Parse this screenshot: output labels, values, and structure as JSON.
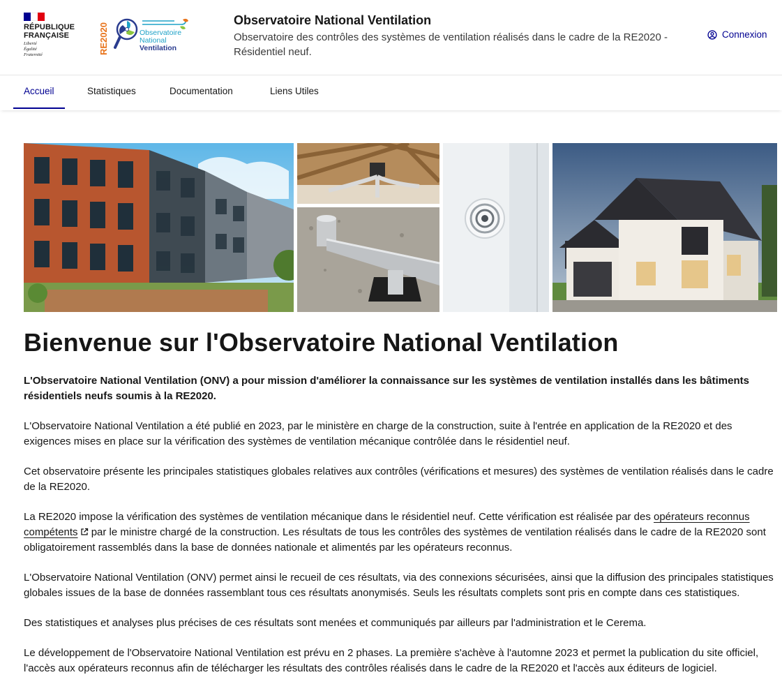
{
  "header": {
    "republic_line1": "RÉPUBLIQUE",
    "republic_line2": "FRANÇAISE",
    "motto_line1": "Liberté",
    "motto_line2": "Égalité",
    "motto_line3": "Fraternité",
    "logo_vertical_text": "RE2020",
    "logo_line1": "Observatoire",
    "logo_line2": "National",
    "logo_line3": "Ventilation",
    "site_title": "Observatoire National Ventilation",
    "site_tagline": "Observatoire des contrôles des systèmes de ventilation réalisés dans le cadre de la RE2020 - Résidentiel neuf.",
    "login_label": "Connexion"
  },
  "nav": {
    "items": [
      {
        "label": "Accueil",
        "active": true
      },
      {
        "label": "Statistiques",
        "active": false
      },
      {
        "label": "Documentation",
        "active": false
      },
      {
        "label": "Liens Utiles",
        "active": false
      }
    ]
  },
  "hero": {
    "images": [
      "apartment-buildings-photo",
      "attic-ventilation-ducts-photo",
      "roof-duct-photo",
      "wall-vent-photo",
      "house-photo"
    ]
  },
  "main": {
    "title": "Bienvenue sur l'Observatoire National Ventilation",
    "lead": "L'Observatoire National Ventilation (ONV) a pour mission d'améliorer la connaissance sur les systèmes de ventilation installés dans les bâtiments résidentiels neufs soumis à la RE2020.",
    "p1": "L'Observatoire National Ventilation a été publié en 2023, par le ministère en charge de la construction, suite à l'entrée en application de la RE2020 et des exigences mises en place sur la vérification des systèmes de ventilation mécanique contrôlée dans le résidentiel neuf.",
    "p2": "Cet observatoire présente les principales statistiques globales relatives aux contrôles (vérifications et mesures) des systèmes de ventilation réalisés dans le cadre de la RE2020.",
    "p3_before": "La RE2020 impose la vérification des systèmes de ventilation mécanique dans le résidentiel neuf. Cette vérification est réalisée par des ",
    "p3_link": "opérateurs reconnus compétents",
    "p3_after": " par le ministre chargé de la construction. Les résultats de tous les contrôles des systèmes de ventilation réalisés dans le cadre de la RE2020 sont obligatoirement rassemblés dans la base de données nationale et alimentés par les opérateurs reconnus.",
    "p4": "L'Observatoire National Ventilation (ONV) permet ainsi le recueil de ces résultats, via des connexions sécurisées, ainsi que la diffusion des principales statistiques globales issues de la base de données rassemblant tous ces résultats anonymisés. Seuls les résultats complets sont pris en compte dans ces statistiques.",
    "p5": "Des statistiques et analyses plus précises de ces résultats sont menées et communiqués par ailleurs par l'administration et le Cerema.",
    "p6": "Le développement de l'Observatoire National Ventilation est prévu en 2 phases. La première s'achève à l'automne 2023 et permet la publication du site officiel, l'accès aux opérateurs reconnus afin de télécharger les résultats des contrôles réalisés dans le cadre de la RE2020 et l'accès aux éditeurs de logiciel."
  },
  "colors": {
    "primary": "#000091",
    "text": "#161616",
    "logo_orange": "#e8741c",
    "logo_blue": "#1fa2c7",
    "logo_navy": "#2a3c8f"
  }
}
